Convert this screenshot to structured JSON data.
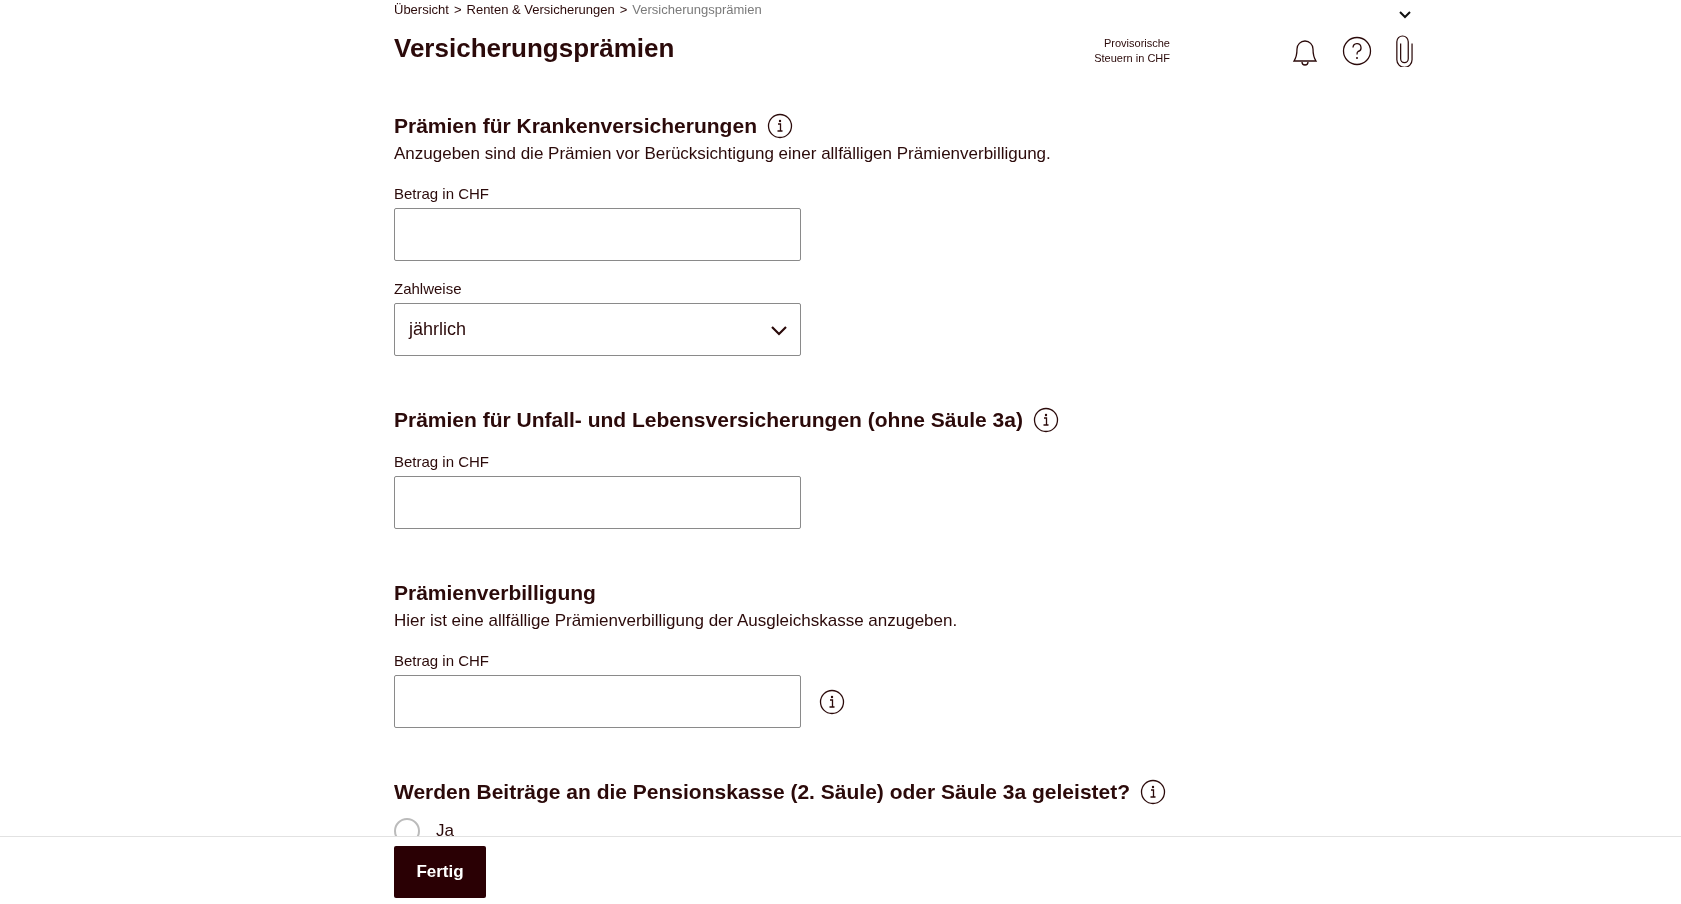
{
  "breadcrumb": [
    {
      "label": "Übersicht",
      "current": false
    },
    {
      "label": "Renten & Versicherungen",
      "current": false
    },
    {
      "label": "Versicherungsprämien",
      "current": true
    }
  ],
  "breadcrumb_separator": ">",
  "title": "Versicherungsprämien",
  "provisional_tax": {
    "line_1": "Provisorische",
    "line_2": "Steuern in CHF"
  },
  "sections": [
    {
      "heading": "Prämien für Krankenversicherungen",
      "info": true,
      "description": "Anzugeben sind die Prämien vor Berücksichtigung einer allfälligen Prämienverbilligung.",
      "fields": [
        {
          "kind": "text",
          "label": "Betrag in CHF",
          "info": false
        },
        {
          "kind": "select",
          "label": "Zahlweise",
          "value": "jährlich",
          "info": false
        }
      ]
    },
    {
      "heading": "Prämien für Unfall- und Lebensversicherungen (ohne Säule 3a)",
      "info": true,
      "fields": [
        {
          "kind": "text",
          "label": "Betrag in CHF",
          "info": false
        }
      ]
    },
    {
      "heading": "Prämienverbilligung",
      "info": false,
      "description": "Hier ist eine allfällige Prämienverbilligung der Ausgleichskasse anzugeben.",
      "fields": [
        {
          "kind": "text",
          "label": "Betrag in CHF",
          "info": true
        }
      ]
    },
    {
      "heading": "Werden Beiträge an die Pensionskasse (2. Säule) oder Säule 3a geleistet?",
      "info": true,
      "options": [
        {
          "label": "Ja",
          "selected": false
        }
      ]
    }
  ],
  "done_button": "Fertig"
}
